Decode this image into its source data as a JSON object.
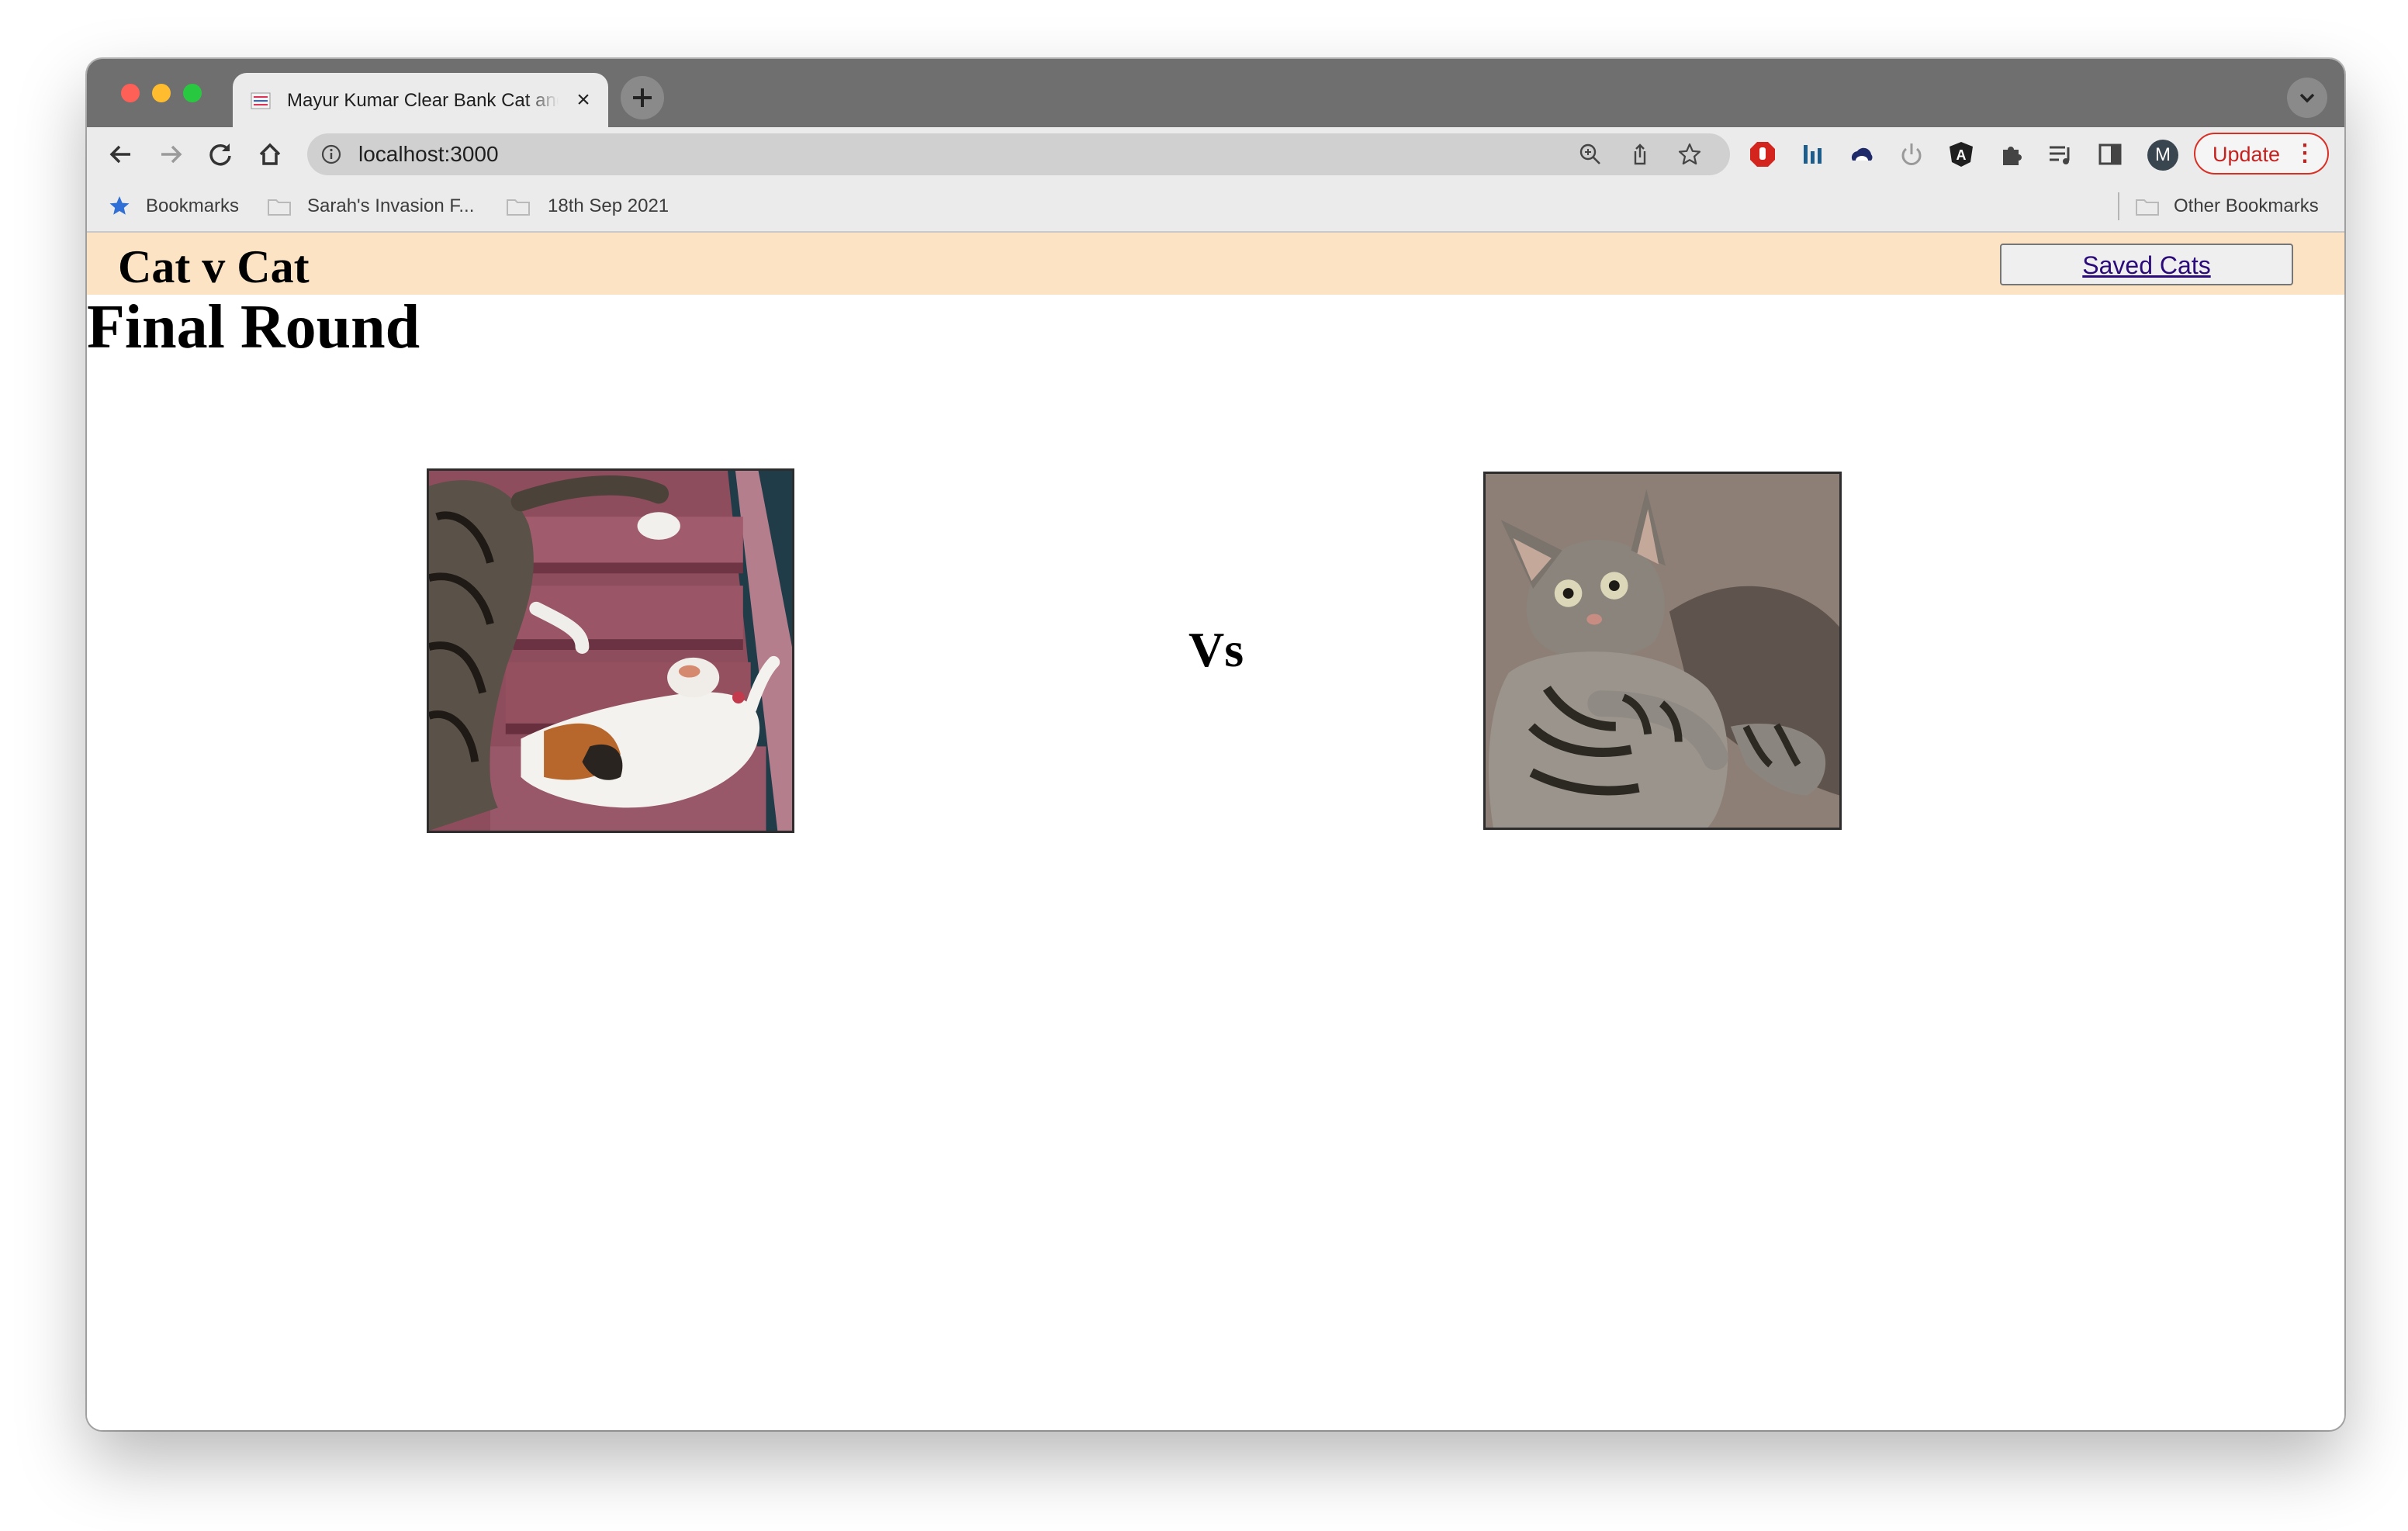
{
  "browser": {
    "tab_title": "Mayur Kumar Clear Bank Cat and Dog App",
    "new_tab_icon": "plus",
    "address": "localhost:3000",
    "profile_initial": "M",
    "update_label": "Update",
    "update_menu": "⋮",
    "update_accent": "#d93025",
    "bookmarks": [
      {
        "label": "Bookmarks",
        "icon": "star-icon"
      },
      {
        "label": "Sarah's Invasion F...",
        "icon": "folder-icon"
      },
      {
        "label": "18th Sep 2021",
        "icon": "folder-icon"
      }
    ],
    "other_bookmarks": "Other Bookmarks"
  },
  "app": {
    "title": "Cat v Cat",
    "saved_cats": "Saved Cats",
    "round_title": "Final Round",
    "versus": "Vs",
    "header_color": "#fce3c4",
    "contestants": [
      {
        "side": "left",
        "image": "two cats playing on carpeted stairs"
      },
      {
        "side": "right",
        "image": "surprised tabby cat sitting upright"
      }
    ]
  }
}
